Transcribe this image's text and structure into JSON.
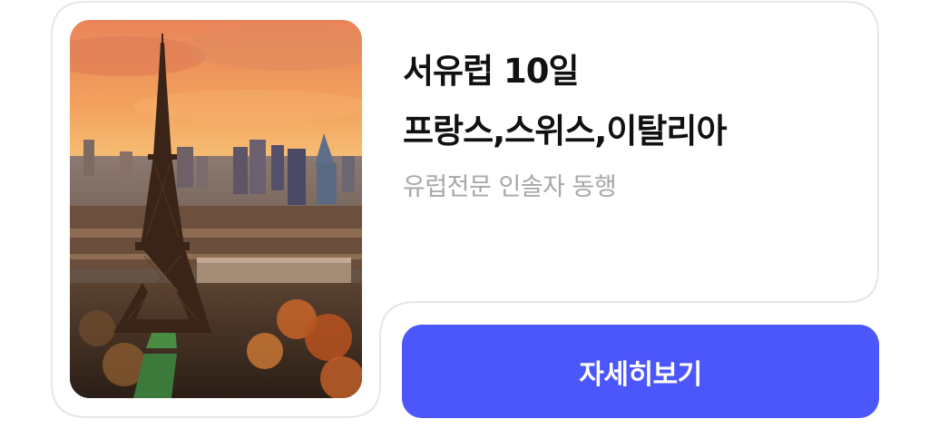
{
  "product": {
    "title_line1": "서유럽 10일",
    "title_line2": "프랑스,스위스,이탈리아",
    "subtitle": "유럽전문 인솔자 동행",
    "image_icon": "eiffel-tower-paris-sunset-photo"
  },
  "actions": {
    "details_label": "자세히보기"
  },
  "colors": {
    "button": "#4b56fb",
    "title": "#111111",
    "subtitle": "#a7a7a7",
    "card_border": "#e6e6e6"
  }
}
